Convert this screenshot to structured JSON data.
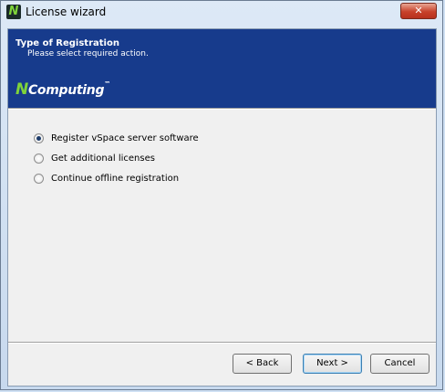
{
  "window": {
    "title": "License wizard",
    "close_label": "✕"
  },
  "header": {
    "title": "Type of Registration",
    "subtitle": "Please select required action.",
    "logo": {
      "n": "N",
      "text": "Computing",
      "tm": "™"
    }
  },
  "options": [
    {
      "label": "Register vSpace server software",
      "checked": true
    },
    {
      "label": "Get additional licenses",
      "checked": false
    },
    {
      "label": "Continue offline registration",
      "checked": false
    }
  ],
  "buttons": {
    "back": "< Back",
    "next": "Next >",
    "cancel": "Cancel"
  }
}
